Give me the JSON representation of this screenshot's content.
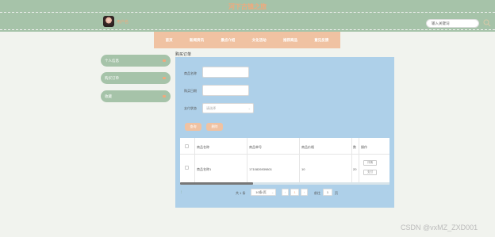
{
  "header": {
    "title": "河下古镇之旅",
    "username": "用户名",
    "search_placeholder": "输入关键词"
  },
  "nav": {
    "items": [
      "首页",
      "新闻资讯",
      "景点介绍",
      "文化活动",
      "推荐商品",
      "意见反馈"
    ]
  },
  "sidebar": {
    "items": [
      "个人信息",
      "购买订单",
      "收藏"
    ]
  },
  "section": {
    "title": "购买订单"
  },
  "form": {
    "label_name": "商品名称",
    "label_date": "购买日期",
    "label_status": "支付状态",
    "status_placeholder": "请选择",
    "btn_search": "查询",
    "btn_delete": "删除"
  },
  "table": {
    "headers": [
      "商品名称",
      "商品单号",
      "商品价格",
      "数",
      "操作"
    ],
    "rows": [
      {
        "name": "商品名称1",
        "order_no": "1710826939801",
        "price": "10",
        "qty": "20",
        "btn_detail": "详情",
        "btn_pay": "支付"
      }
    ]
  },
  "pagination": {
    "total": "共 1 条",
    "page_size": "10条/页",
    "current": "1",
    "goto_label": "前往",
    "goto_value": "1",
    "goto_unit": "页"
  },
  "watermark": "CSDN @vxMZ_ZXD001",
  "colors": {
    "header": "#a6c3a9",
    "accent": "#f0c2a2",
    "panel": "#aed0e9",
    "title": "#f0a97c"
  }
}
